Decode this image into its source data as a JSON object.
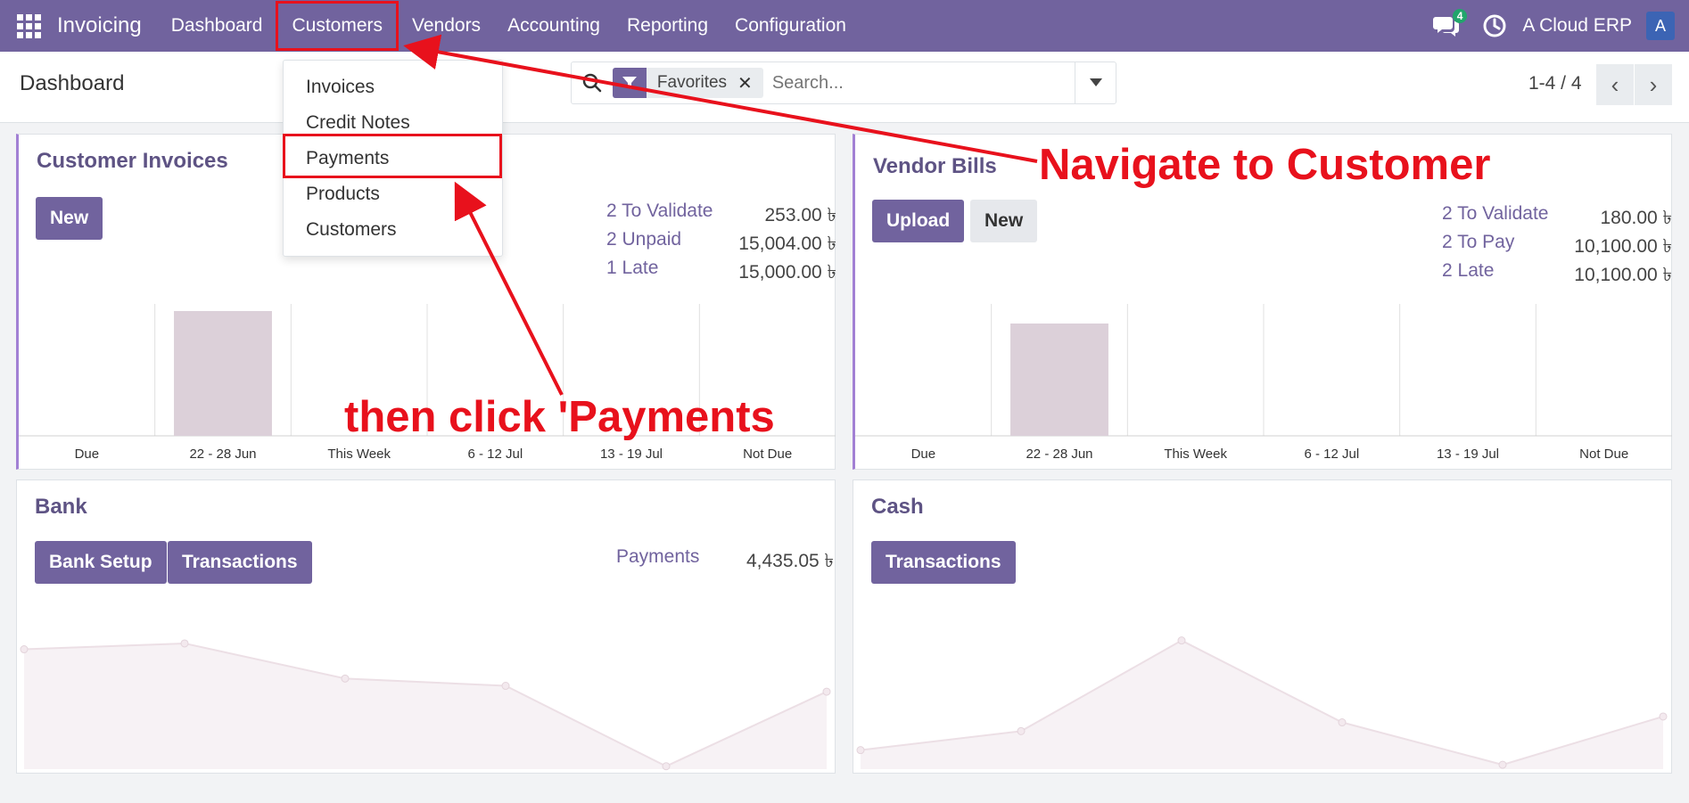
{
  "navbar": {
    "brand": "Invoicing",
    "items": [
      "Dashboard",
      "Customers",
      "Vendors",
      "Accounting",
      "Reporting",
      "Configuration"
    ],
    "chat_badge": "4",
    "company": "A Cloud ERP",
    "avatar_letter": "A"
  },
  "control": {
    "title": "Dashboard",
    "facet_label": "Favorites",
    "facet_remove": "✕",
    "search_placeholder": "Search...",
    "pager": "1-4 / 4",
    "prev": "‹",
    "next": "›"
  },
  "dropdown": {
    "items": [
      "Invoices",
      "Credit Notes",
      "Payments",
      "Products",
      "Customers"
    ]
  },
  "customer_invoices": {
    "title": "Customer Invoices",
    "new_label": "New",
    "stats": [
      {
        "label": "2 To Validate",
        "value": "253.00 ৳"
      },
      {
        "label": "2 Unpaid",
        "value": "15,004.00 ৳"
      },
      {
        "label": "1 Late",
        "value": "15,000.00 ৳"
      }
    ],
    "chart_data": {
      "type": "bar",
      "categories": [
        "Due",
        "22 - 28 Jun",
        "This Week",
        "6 - 12 Jul",
        "13 - 19 Jul",
        "Not Due"
      ],
      "values": [
        0,
        15004,
        0,
        0,
        0,
        0
      ],
      "bar_color": "#dcd0d9"
    }
  },
  "vendor_bills": {
    "title": "Vendor Bills",
    "upload_label": "Upload",
    "new_label": "New",
    "stats": [
      {
        "label": "2 To Validate",
        "value": "180.00 ৳"
      },
      {
        "label": "2 To Pay",
        "value": "10,100.00 ৳"
      },
      {
        "label": "2 Late",
        "value": "10,100.00 ৳"
      }
    ],
    "chart_data": {
      "type": "bar",
      "categories": [
        "Due",
        "22 - 28 Jun",
        "This Week",
        "6 - 12 Jul",
        "13 - 19 Jul",
        "Not Due"
      ],
      "values": [
        0,
        10100,
        0,
        0,
        0,
        0
      ],
      "bar_color": "#dcd0d9"
    }
  },
  "bank": {
    "title": "Bank",
    "setup_label": "Bank Setup",
    "transactions_label": "Transactions",
    "stat_label": "Payments",
    "stat_value": "4,435.05 ৳",
    "chart_data": {
      "type": "area",
      "values": [
        0.82,
        0.86,
        0.62,
        0.57,
        0.02,
        0.53
      ]
    }
  },
  "cash": {
    "title": "Cash",
    "transactions_label": "Transactions",
    "chart_data": {
      "type": "area",
      "values": [
        0.13,
        0.26,
        0.88,
        0.32,
        0.03,
        0.36
      ]
    }
  },
  "annotations": {
    "navigate": "Navigate to Customer",
    "click": "then click 'Payments"
  },
  "colors": {
    "brand": "#71639e",
    "annotation": "#e8111c"
  }
}
